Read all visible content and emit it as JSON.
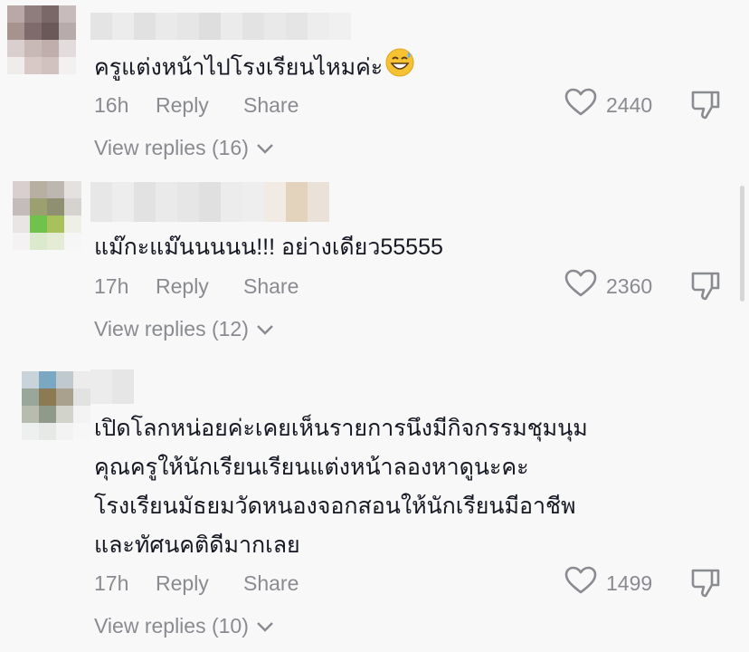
{
  "comments": [
    {
      "text": "ครูแต่งหน้าไปโรงเรียนไหมค่ะ",
      "emoji": "grinning-sweat-emoji",
      "time": "16h",
      "reply_label": "Reply",
      "share_label": "Share",
      "likes": "2440",
      "view_replies": "View replies (16)"
    },
    {
      "text": "แม๊กะแม๊นนนนน!!! อย่างเดียว55555",
      "time": "17h",
      "reply_label": "Reply",
      "share_label": "Share",
      "likes": "2360",
      "view_replies": "View replies (12)"
    },
    {
      "text_lines": [
        "เปิดโลกหน่อยค่ะเคยเห็นรายการนึงมีกิจกรรมชุมนุม",
        "คุณครูให้นักเรียนเรียนแต่งหน้าลองหาดูนะคะ",
        "โรงเรียนมัธยมวัดหนองจอกสอนให้นักเรียนมีอาชีพ",
        "และทัศนคติดีมากเลย"
      ],
      "time": "17h",
      "reply_label": "Reply",
      "share_label": "Share",
      "likes": "1499",
      "view_replies": "View replies (10)"
    }
  ],
  "colors": {
    "background": "#f8f8f8",
    "text": "#161823",
    "secondary_text": "#8a8b91"
  },
  "icons": [
    "heart-outline-icon",
    "thumbs-down-icon",
    "chevron-down-icon"
  ]
}
